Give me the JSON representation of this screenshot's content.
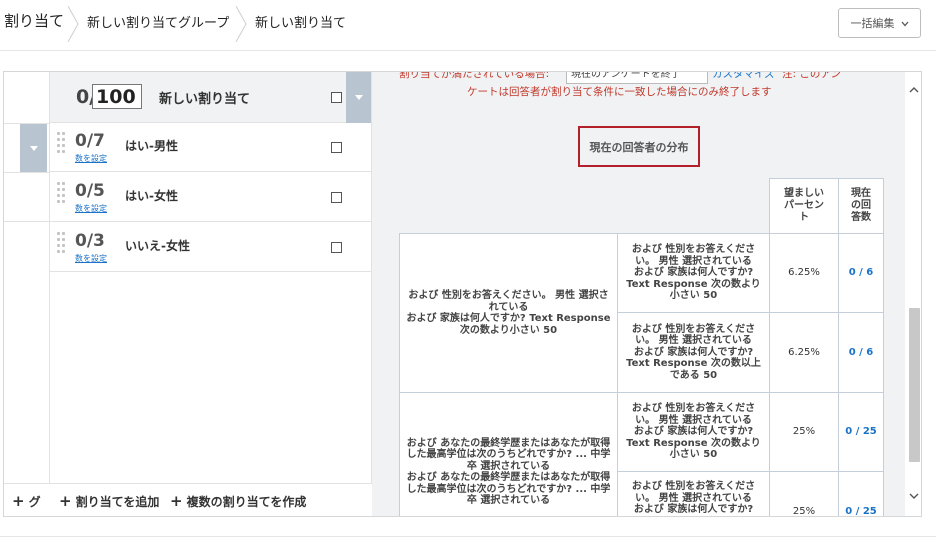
{
  "breadcrumb": {
    "items": [
      "割り当て",
      "新しい割り当てグループ",
      "新しい割り当て"
    ]
  },
  "bulk_edit": {
    "label": "一括編集"
  },
  "quota_header": {
    "count_prefix": "0/",
    "total_value": "100",
    "name": "新しい割り当て"
  },
  "quotas": [
    {
      "count": "0/7",
      "link": "数を設定",
      "name": "はい-男性"
    },
    {
      "count": "0/5",
      "link": "数を設定",
      "name": "はい-女性"
    },
    {
      "count": "0/3",
      "link": "数を設定",
      "name": "いいえ-女性"
    }
  ],
  "bottom_bar": {
    "group_label": "グ",
    "add_quota": "割り当てを追加",
    "create_multiple": "複数の割り当てを作成"
  },
  "condition": {
    "line1_prefix": "割り当てが満たされている場合:",
    "select_value": "現在のアンケートを終了",
    "custom_link": "カスタマイズ",
    "note_start": "注: このアン",
    "line2": "ケートは回答者が割り当て条件に一致した場合にのみ終了します"
  },
  "distribution": {
    "title": "現在の回答者の分布",
    "col_desired": "望ましいパーセント",
    "col_current": "現在の回答数",
    "groups": [
      {
        "condition": "および 性別をお答えください。 男性 選択されている\nおよび 家族は何人ですか? Text Response 次の数より小さい 50",
        "rows": [
          {
            "sub": "および 性別をお答えください。 男性 選択されている\nおよび 家族は何人ですか?\nText Response 次の数より小さい 50",
            "pct": "6.25%",
            "count": "0 / 6"
          },
          {
            "sub": "および 性別をお答えください。 男性 選択されている\nおよび 家族は何人ですか?\nText Response 次の数以上である 50",
            "pct": "6.25%",
            "count": "0 / 6"
          }
        ]
      },
      {
        "condition": "および あなたの最終学歴またはあなたが取得した最高学位は次のうちどれですか? ... 中学卒 選択されている\nおよび あなたの最終学歴またはあなたが取得した最高学位は次のうちどれですか? ... 中学卒 選択されている",
        "rows": [
          {
            "sub": "および 性別をお答えください。 男性 選択されている\nおよび 家族は何人ですか?\nText Response 次の数より小さい 50",
            "pct": "25%",
            "count": "0 / 25"
          },
          {
            "sub": "および 性別をお答えください。 男性 選択されている\nおよび 家族は何人ですか?",
            "pct": "25%",
            "count": "0 / 25"
          }
        ]
      }
    ]
  },
  "colors": {
    "accent_red": "#b3202a",
    "link_blue": "#1a73c8",
    "toggle_blue": "#b8c4d0",
    "panel_bg": "#f1f2f4"
  }
}
